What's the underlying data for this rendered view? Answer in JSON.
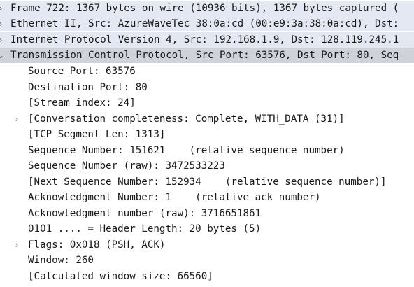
{
  "packet_tree": {
    "frame": "Frame 722: 1367 bytes on wire (10936 bits), 1367 bytes captured (",
    "ethernet": "Ethernet II, Src: AzureWaveTec_38:0a:cd (00:e9:3a:38:0a:cd), Dst:",
    "ip": "Internet Protocol Version 4, Src: 192.168.1.9, Dst: 128.119.245.1",
    "tcp": "Transmission Control Protocol, Src Port: 63576, Dst Port: 80, Seq",
    "tcp_fields": {
      "source_port": "Source Port: 63576",
      "destination_port": "Destination Port: 80",
      "stream_index": "[Stream index: 24]",
      "conversation_completeness": "[Conversation completeness: Complete, WITH_DATA (31)]",
      "segment_len": "[TCP Segment Len: 1313]",
      "sequence_number": "Sequence Number: 151621    (relative sequence number)",
      "sequence_number_raw": "Sequence Number (raw): 3472533223",
      "next_sequence_number": "[Next Sequence Number: 152934    (relative sequence number)]",
      "ack_number": "Acknowledgment Number: 1    (relative ack number)",
      "ack_number_raw": "Acknowledgment number (raw): 3716651861",
      "header_length": "0101 .... = Header Length: 20 bytes (5)",
      "flags": "Flags: 0x018 (PSH, ACK)",
      "window": "Window: 260",
      "calculated_window_size": "[Calculated window size: 66560]"
    }
  },
  "icons": {
    "collapsed": "chevron-right-icon",
    "expanded": "chevron-down-icon"
  },
  "colors": {
    "top_row_bg": "#e4e8f2",
    "selected_row_bg": "#cfd3d9"
  }
}
